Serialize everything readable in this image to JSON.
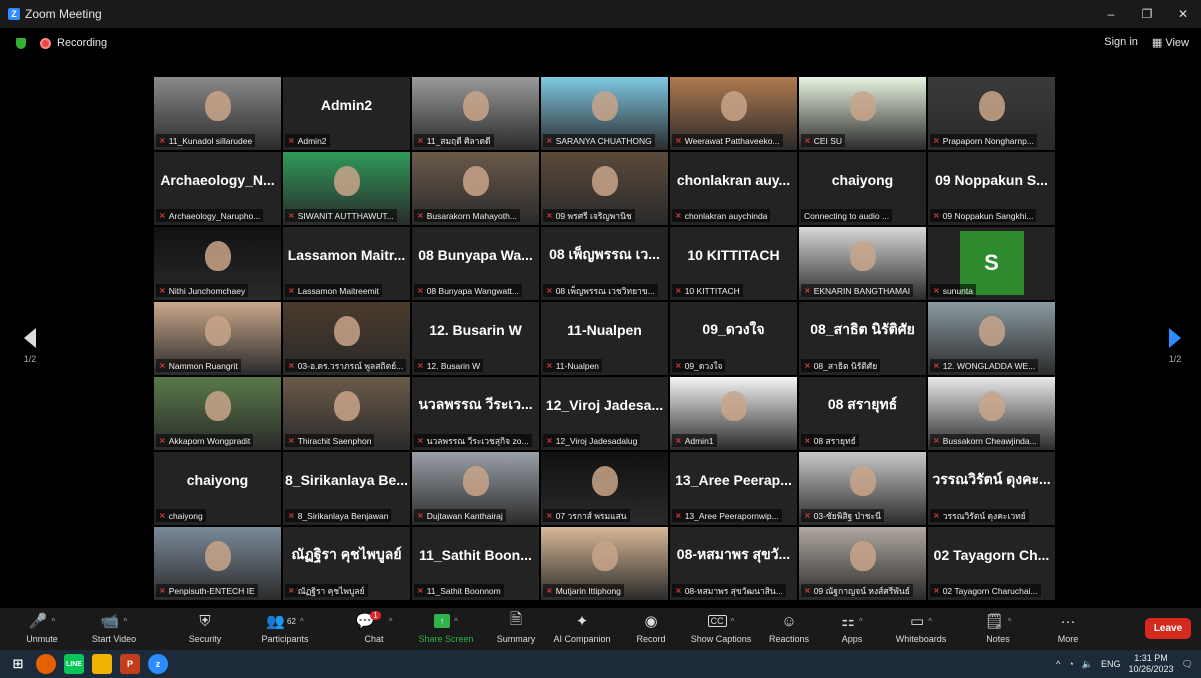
{
  "window": {
    "title": "Zoom Meeting",
    "minimize": "–",
    "maximize": "❐",
    "close": "✕"
  },
  "recording": {
    "label": "Recording"
  },
  "topright": {
    "signin": "Sign in",
    "view": "View"
  },
  "pager": {
    "left": "1/2",
    "right": "1/2"
  },
  "tiles": [
    {
      "name": "11_Kunadol sillarudee",
      "video": true,
      "color": "#8a8a8a"
    },
    {
      "name": "Admin2",
      "big": "Admin2"
    },
    {
      "name": "11_สมฤดี ศิลาดดี",
      "video": true,
      "color": "#9a9a9a"
    },
    {
      "name": "SARANYA CHUATHONG",
      "video": true,
      "color": "#7ec8e3"
    },
    {
      "name": "Weerawat Patthaveeko...",
      "video": true,
      "color": "#b07a4f"
    },
    {
      "name": "CEI SU",
      "video": true,
      "color": "#e8f5e0",
      "active": true
    },
    {
      "name": "Prapaporn Nongharnp...",
      "video": true,
      "color": "#3a3a3a"
    },
    {
      "name": "Archaeology_Narupho...",
      "big": "Archaeology_N..."
    },
    {
      "name": "SIWANIT AUTTHAWUT...",
      "video": true,
      "color": "#2e9a5a"
    },
    {
      "name": "Busarakorn Mahayoth...",
      "video": true,
      "color": "#6a5a4a"
    },
    {
      "name": "09 พรศรี เจริญพานิช",
      "video": true,
      "color": "#5a4a3a"
    },
    {
      "name": "chonlakran auychinda",
      "big": "chonlakran auy..."
    },
    {
      "name": "Connecting to audio ...",
      "big": "chaiyong",
      "nomic": true
    },
    {
      "name": "09 Noppakun Sangkhi...",
      "big": "09 Noppakun S..."
    },
    {
      "name": "Nithi Junchomchaey",
      "video": true,
      "color": "#111"
    },
    {
      "name": "Lassamon Maitreemit",
      "big": "Lassamon Maitr..."
    },
    {
      "name": "08 Bunyapa Wangwatt...",
      "big": "08 Bunyapa Wa..."
    },
    {
      "name": "08 เพ็ญพรรณ เวชวิทยาข...",
      "big": "08 เพ็ญพรรณ เว..."
    },
    {
      "name": "10 KITTITACH",
      "big": "10 KITTITACH"
    },
    {
      "name": "EKNARIN BANGTHAMAI",
      "video": true,
      "color": "#d8d8d8"
    },
    {
      "name": "sununta",
      "avatar": "S"
    },
    {
      "name": "Nammon Ruangrit",
      "video": true,
      "color": "#c9a88a"
    },
    {
      "name": "03-อ.ดร.วราภรณ์ พูลสถิตย์...",
      "video": true,
      "color": "#4a3a2a"
    },
    {
      "name": "12. Busarin W",
      "big": "12. Busarin W"
    },
    {
      "name": "11-Nualpen",
      "big": "11-Nualpen"
    },
    {
      "name": "09_ดวงใจ",
      "big": "09_ดวงใจ"
    },
    {
      "name": "08_สาธิต นิรัติศัย",
      "big": "08_สาธิต นิรัติศัย"
    },
    {
      "name": "12. WONGLADDA WE...",
      "video": true,
      "color": "#8a9aa0"
    },
    {
      "name": "Akkaporn Wongpradit",
      "video": true,
      "color": "#5a7a4a"
    },
    {
      "name": "Thirachit Saenphon",
      "video": true,
      "color": "#6a5a4a"
    },
    {
      "name": "นวลพรรณ วีระเวชสุกิจ zo...",
      "big": "นวลพรรณ วีระเว..."
    },
    {
      "name": "12_Viroj Jadesadalug",
      "big": "12_Viroj Jadesa..."
    },
    {
      "name": "Admin1",
      "video": true,
      "color": "#f5f5f5"
    },
    {
      "name": "08 สรายุทธ์",
      "big": "08 สรายุทธ์"
    },
    {
      "name": "Bussakorn Cheawjinda...",
      "video": true,
      "color": "#e8e8e8"
    },
    {
      "name": "chaiyong",
      "big": "chaiyong"
    },
    {
      "name": "8_Sirikanlaya Benjawan",
      "big": "8_Sirikanlaya Be..."
    },
    {
      "name": "Dujtawan Kanthairaj",
      "video": true,
      "color": "#9aa0a8"
    },
    {
      "name": "07 วรกาส์ พรมแสน",
      "video": true,
      "color": "#111"
    },
    {
      "name": "13_Aree Peerapornwip...",
      "big": "13_Aree Peerap..."
    },
    {
      "name": "03-ชัยพิสิฐ ป่าชะนี",
      "video": true,
      "color": "#c8c8c8"
    },
    {
      "name": "วรรณวิรัตน์ ดุงคะเวทย์",
      "big": "วรรณวิรัตน์ ดุงคะ..."
    },
    {
      "name": "Penpisuth-ENTECH IE",
      "video": true,
      "color": "#7a8a9a"
    },
    {
      "name": "ณัฏฐิรา คุชไพบูลย์",
      "big": "ณัฏฐิรา คุชไพบูลย์"
    },
    {
      "name": "11_Sathit Boonnom",
      "big": "11_Sathit Boon..."
    },
    {
      "name": "Mutjarin Ittiphong",
      "video": true,
      "color": "#d8b898"
    },
    {
      "name": "08-หสมาพร สุขวัฒนาสิน...",
      "big": "08-หสมาพร สุขวั..."
    },
    {
      "name": "09 ณัฐกาญจน์ หงส์ศรีพันธ์",
      "video": true,
      "color": "#b0a8a0"
    },
    {
      "name": "02 Tayagorn Charuchai...",
      "big": "02 Tayagorn Ch..."
    }
  ],
  "toolbar": {
    "unmute": "Unmute",
    "start_video": "Start Video",
    "security": "Security",
    "participants": "Participants",
    "participant_count": "62",
    "chat": "Chat",
    "chat_badge": "1",
    "share_screen": "Share Screen",
    "summary": "Summary",
    "ai_companion": "AI Companion",
    "record": "Record",
    "show_captions": "Show Captions",
    "reactions": "Reactions",
    "apps": "Apps",
    "whiteboards": "Whiteboards",
    "notes": "Notes",
    "more": "More",
    "leave": "Leave"
  },
  "taskbar": {
    "lang": "ENG",
    "time": "1:31 PM",
    "date": "10/26/2023"
  }
}
